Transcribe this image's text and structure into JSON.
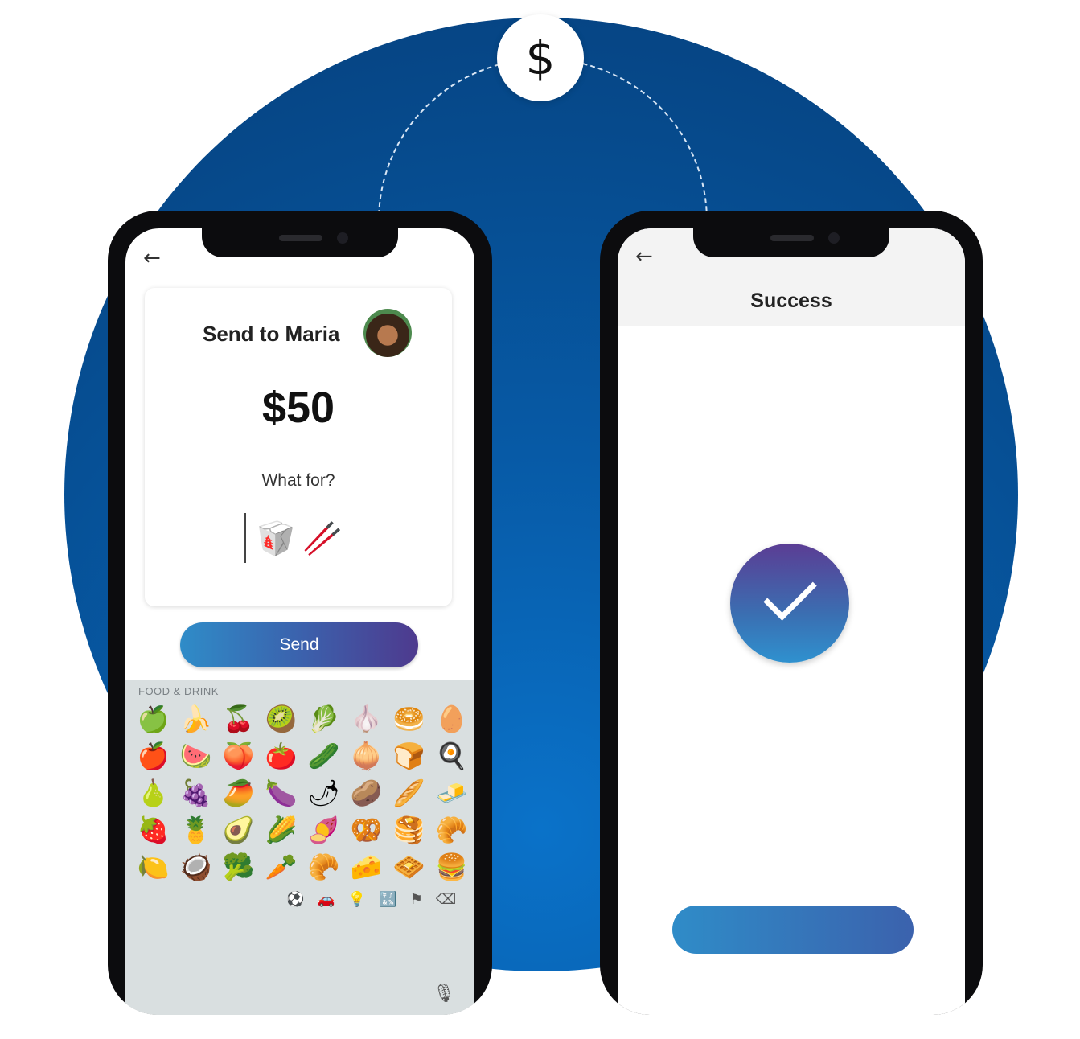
{
  "badge": {
    "symbol": "$"
  },
  "left_phone": {
    "back_icon": "←",
    "card": {
      "title": "Send to Maria",
      "amount": "$50",
      "prompt": "What for?",
      "selected_emojis": [
        "🥡",
        "🥢"
      ]
    },
    "send_label": "Send",
    "keyboard": {
      "category": "FOOD & DRINK",
      "emojis": [
        "🍏",
        "🍌",
        "🍒",
        "🥝",
        "🥬",
        "🧄",
        "🥯",
        "🥚",
        "🍎",
        "🍉",
        "🍑",
        "🍅",
        "🥒",
        "🧅",
        "🍞",
        "🍳",
        "🍐",
        "🍇",
        "🥭",
        "🍆",
        "🌶",
        "🥔",
        "🥖",
        "🧈",
        "🍓",
        "🍍",
        "🥑",
        "🌽",
        "🍠",
        "🥨",
        "🥞",
        "🥐",
        "🍋",
        "🥥",
        "🥦",
        "🥕",
        "🥐",
        "🧀",
        "🧇",
        "🍔"
      ],
      "toolbar_icons": [
        "⚽",
        "🚗",
        "💡",
        "🔣",
        "⚑",
        "⌫"
      ],
      "mic_icon": "🎙"
    }
  },
  "right_phone": {
    "back_icon": "←",
    "title": "Success"
  }
}
